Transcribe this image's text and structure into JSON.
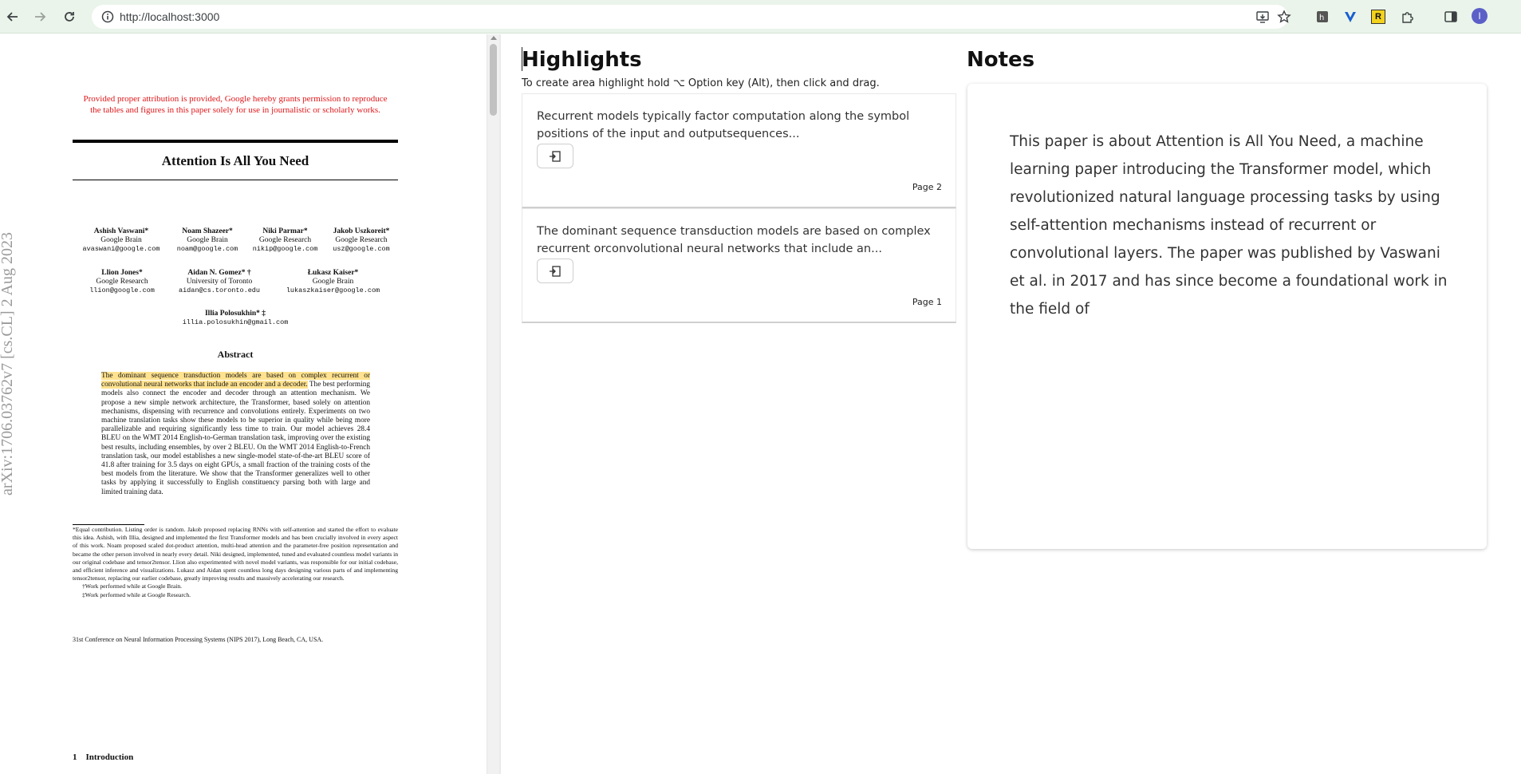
{
  "browser": {
    "url": "http://localhost:3000",
    "profile_initial": "I",
    "extension_r_label": "R"
  },
  "pdf": {
    "arxiv_stamp": "arXiv:1706.03762v7  [cs.CL]  2 Aug 2023",
    "notice": "Provided proper attribution is provided, Google hereby grants permission to reproduce the tables and figures in this paper solely for use in journalistic or scholarly works.",
    "title": "Attention Is All You Need",
    "authors": [
      {
        "name": "Ashish Vaswani*",
        "affiliation": "Google Brain",
        "email": "avaswani@google.com"
      },
      {
        "name": "Noam Shazeer*",
        "affiliation": "Google Brain",
        "email": "noam@google.com"
      },
      {
        "name": "Niki Parmar*",
        "affiliation": "Google Research",
        "email": "nikip@google.com"
      },
      {
        "name": "Jakob Uszkoreit*",
        "affiliation": "Google Research",
        "email": "usz@google.com"
      },
      {
        "name": "Llion Jones*",
        "affiliation": "Google Research",
        "email": "llion@google.com"
      },
      {
        "name": "Aidan N. Gomez* †",
        "affiliation": "University of Toronto",
        "email": "aidan@cs.toronto.edu"
      },
      {
        "name": "Łukasz Kaiser*",
        "affiliation": "Google Brain",
        "email": "lukaszkaiser@google.com"
      },
      {
        "name": "Illia Polosukhin* ‡",
        "affiliation": "",
        "email": "illia.polosukhin@gmail.com"
      }
    ],
    "abstract_heading": "Abstract",
    "abstract_highlighted": "The dominant sequence transduction models are based on complex recurrent or convolutional neural networks that include an encoder and a decoder.",
    "abstract_rest": " The best performing models also connect the encoder and decoder through an attention mechanism. We propose a new simple network architecture, the Transformer, based solely on attention mechanisms, dispensing with recurrence and convolutions entirely. Experiments on two machine translation tasks show these models to be superior in quality while being more parallelizable and requiring significantly less time to train. Our model achieves 28.4 BLEU on the WMT 2014 English-to-German translation task, improving over the existing best results, including ensembles, by over 2 BLEU. On the WMT 2014 English-to-French translation task, our model establishes a new single-model state-of-the-art BLEU score of 41.8 after training for 3.5 days on eight GPUs, a small fraction of the training costs of the best models from the literature. We show that the Transformer generalizes well to other tasks by applying it successfully to English constituency parsing both with large and limited training data.",
    "footnote_main": "*Equal contribution. Listing order is random. Jakob proposed replacing RNNs with self-attention and started the effort to evaluate this idea. Ashish, with Illia, designed and implemented the first Transformer models and has been crucially involved in every aspect of this work. Noam proposed scaled dot-product attention, multi-head attention and the parameter-free position representation and became the other person involved in nearly every detail. Niki designed, implemented, tuned and evaluated countless model variants in our original codebase and tensor2tensor. Llion also experimented with novel model variants, was responsible for our initial codebase, and efficient inference and visualizations. Lukasz and Aidan spent countless long days designing various parts of and implementing tensor2tensor, replacing our earlier codebase, greatly improving results and massively accelerating our research.",
    "footnote_brain": "†Work performed while at Google Brain.",
    "footnote_research": "‡Work performed while at Google Research.",
    "conference": "31st Conference on Neural Information Processing Systems (NIPS 2017), Long Beach, CA, USA.",
    "section_heading": "1    Introduction"
  },
  "highlights": {
    "title": "Highlights",
    "hint": "To create area highlight hold ⌥ Option key (Alt), then click and drag.",
    "items": [
      {
        "text": "Recurrent models typically factor computation along the symbol positions of the input and outputsequences...",
        "page": "Page 2"
      },
      {
        "text": "The dominant sequence transduction models are based on complex recurrent orconvolutional neural networks that include an...",
        "page": "Page 1"
      }
    ]
  },
  "notes": {
    "title": "Notes",
    "body": "This paper is about Attention is All You Need, a machine learning paper introducing the Transformer model, which revolutionized natural language processing tasks by using self-attention mechanisms instead of recurrent or convolutional layers. The paper was published by Vaswani et al. in 2017 and has since become a foundational work in the field of"
  },
  "colors": {
    "toolbar_bg": "#eaf4ea",
    "highlight": "#ffe28f",
    "notice_red": "#e0171a"
  }
}
